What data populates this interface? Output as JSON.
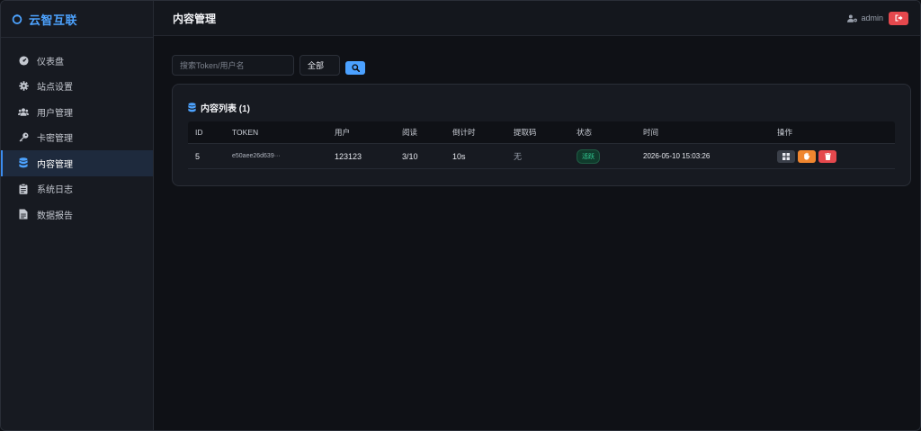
{
  "app": {
    "brand": "云智互联"
  },
  "sidebar": {
    "items": [
      {
        "label": "仪表盘",
        "icon": "dashboard-icon"
      },
      {
        "label": "站点设置",
        "icon": "gear-icon"
      },
      {
        "label": "用户管理",
        "icon": "users-icon"
      },
      {
        "label": "卡密管理",
        "icon": "key-icon"
      },
      {
        "label": "内容管理",
        "icon": "database-icon",
        "active": true
      },
      {
        "label": "系统日志",
        "icon": "clipboard-icon"
      },
      {
        "label": "数据报告",
        "icon": "file-icon"
      }
    ]
  },
  "header": {
    "title": "内容管理",
    "user": "admin"
  },
  "filters": {
    "search_placeholder": "搜索Token/用户名",
    "select_value": "全部"
  },
  "content": {
    "title": "内容列表 (1)",
    "columns": [
      "ID",
      "TOKEN",
      "用户",
      "阅读",
      "倒计时",
      "提取码",
      "状态",
      "时间",
      "操作"
    ],
    "rows": [
      {
        "id": "5",
        "token": "e50aee26d639···",
        "user": "123123",
        "reads": "3/10",
        "countdown": "10s",
        "code": "无",
        "status": "活跃",
        "time": "2026-05-10 15:03:26"
      }
    ]
  },
  "colors": {
    "accent": "#4da3ff",
    "danger": "#e5484d",
    "warning": "#f0862f",
    "success": "#34d399"
  }
}
